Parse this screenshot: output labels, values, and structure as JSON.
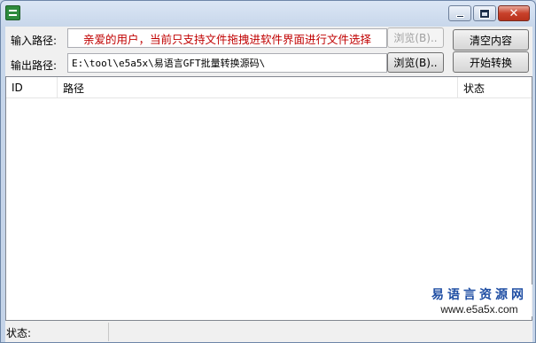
{
  "window": {
    "title": ""
  },
  "form": {
    "input_label": "输入路径:",
    "input_value": "亲爱的用户，当前只支持文件拖拽进软件界面进行文件选择",
    "browse_input_label": "浏览(B)..",
    "output_label": "输出路径:",
    "output_value": "E:\\tool\\e5a5x\\易语言GFT批量转换源码\\",
    "browse_output_label": "浏览(B).."
  },
  "actions": {
    "clear_label": "清空内容",
    "convert_label": "开始转换"
  },
  "list": {
    "columns": [
      "ID",
      "路径",
      "状态"
    ],
    "rows": []
  },
  "statusbar": {
    "label": "状态:"
  },
  "watermark": {
    "title": "易语言资源网",
    "url": "www.e5a5x.com"
  }
}
